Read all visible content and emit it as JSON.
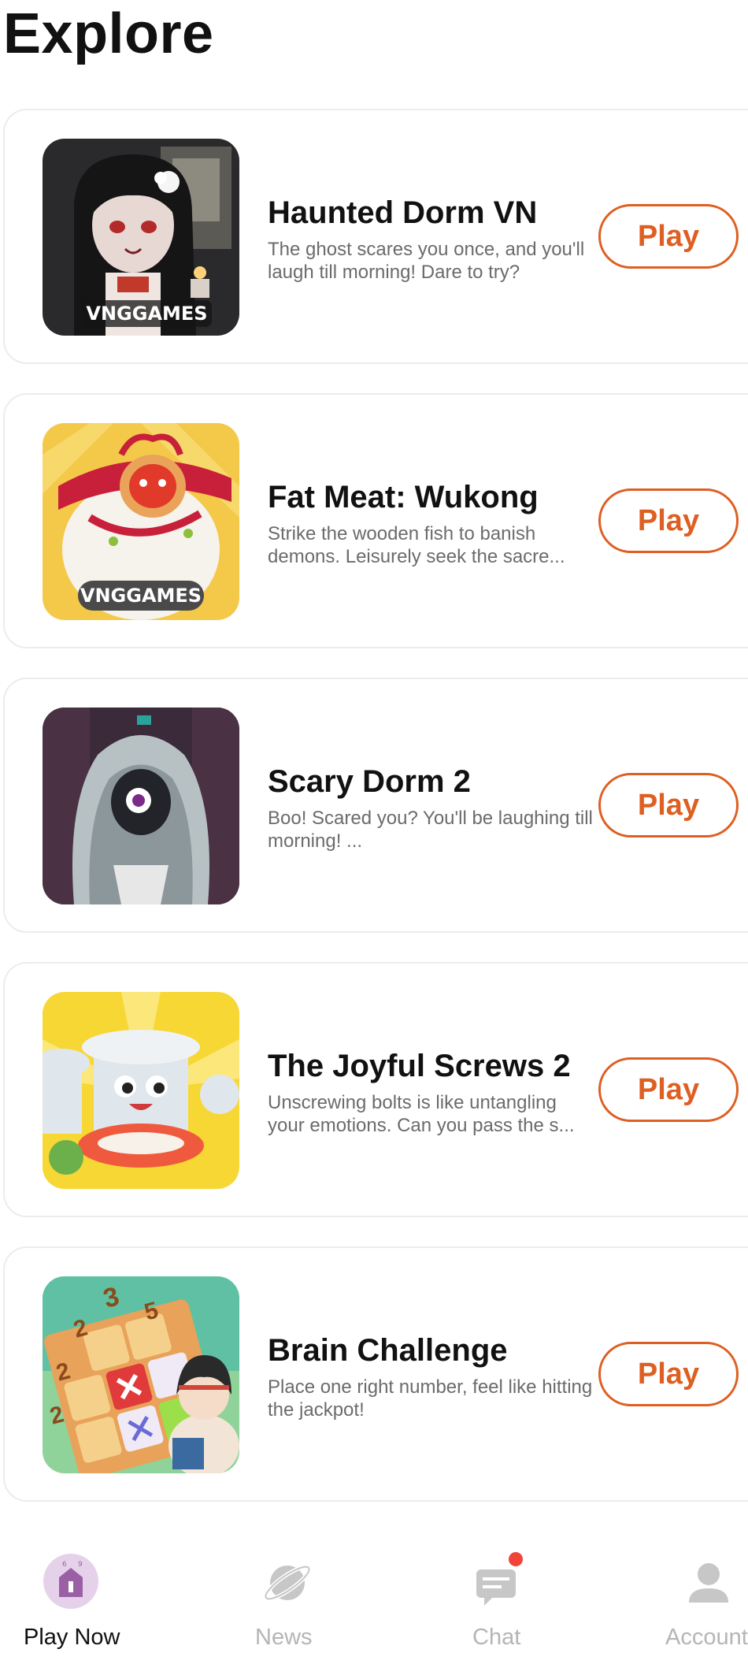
{
  "page": {
    "title": "Explore"
  },
  "games": [
    {
      "title": "Haunted Dorm VN",
      "description": "The ghost scares you once, and you'll laugh till morning! Dare to try?",
      "play_label": "Play",
      "thumbnail_badge": "VNGGAMES"
    },
    {
      "title": "Fat Meat: Wukong",
      "description": "Strike the wooden fish to banish demons. Leisurely seek the sacre...",
      "play_label": "Play",
      "thumbnail_badge": "VNGGAMES"
    },
    {
      "title": "Scary Dorm 2",
      "description": "Boo! Scared you? You'll be laughing till morning! ...",
      "play_label": "Play"
    },
    {
      "title": "The Joyful Screws 2",
      "description": "Unscrewing bolts is like untangling your emotions. Can you pass the s...",
      "play_label": "Play"
    },
    {
      "title": "Brain Challenge",
      "description": "Place one right number, feel like hitting the jackpot!",
      "play_label": "Play",
      "thumbnail_numbers": [
        "3",
        "5",
        "2",
        "2",
        "2"
      ]
    }
  ],
  "bottom_nav": {
    "items": [
      {
        "label": "Play Now",
        "icon": "play-now-icon",
        "active": true
      },
      {
        "label": "News",
        "icon": "planet-icon",
        "active": false
      },
      {
        "label": "Chat",
        "icon": "chat-icon",
        "active": false,
        "has_notification": true
      },
      {
        "label": "Account",
        "icon": "user-icon",
        "active": false
      }
    ]
  },
  "colors": {
    "accent": "#de5f22",
    "nav_active": "#111111",
    "nav_inactive": "#b5b5b5",
    "notification": "#f04438",
    "play_now_icon": "#9b5fa6"
  }
}
